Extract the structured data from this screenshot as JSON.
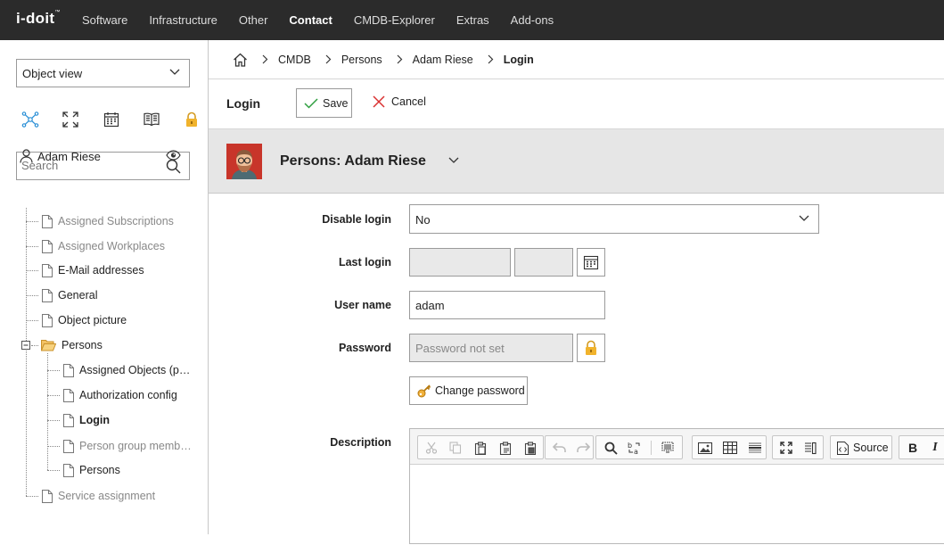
{
  "app": {
    "logo": "i-doit",
    "logo_tm": "™"
  },
  "topnav": {
    "items": [
      "Software",
      "Infrastructure",
      "Other",
      "Contact",
      "CMDB-Explorer",
      "Extras",
      "Add-ons"
    ],
    "active": "Contact"
  },
  "sidebar": {
    "view_select": "Object view",
    "tools": [
      "relations-icon",
      "fullscreen-icon",
      "calendar-icon",
      "book-icon",
      "lock-icon"
    ],
    "search_placeholder": "Search",
    "root": "Adam Riese",
    "items": [
      {
        "label": "Assigned Subscriptions",
        "muted": true
      },
      {
        "label": "Assigned Workplaces",
        "muted": true
      },
      {
        "label": "E-Mail addresses",
        "muted": false
      },
      {
        "label": "General",
        "muted": false
      },
      {
        "label": "Object picture",
        "muted": false
      },
      {
        "label": "Persons",
        "muted": false,
        "folder": true
      },
      {
        "label": "Assigned Objects (p…",
        "muted": false
      },
      {
        "label": "Authorization config",
        "muted": false
      },
      {
        "label": "Login",
        "muted": false,
        "bold": true
      },
      {
        "label": "Person group memb…",
        "muted": true
      },
      {
        "label": "Persons",
        "muted": false
      },
      {
        "label": "Service assignment",
        "muted": true
      }
    ]
  },
  "breadcrumb": [
    "CMDB",
    "Persons",
    "Adam Riese",
    "Login"
  ],
  "actionbar": {
    "title": "Login",
    "save": "Save",
    "cancel": "Cancel"
  },
  "object": {
    "title": "Persons: Adam Riese"
  },
  "form": {
    "disable_login": {
      "label": "Disable login",
      "value": "No"
    },
    "last_login": {
      "label": "Last login",
      "date": "",
      "time": ""
    },
    "username": {
      "label": "User name",
      "value": "adam"
    },
    "password": {
      "label": "Password",
      "placeholder": "Password not set"
    },
    "change_password": "Change password",
    "description": {
      "label": "Description",
      "source_label": "Source"
    }
  },
  "colors": {
    "topbar": "#2b2b2b",
    "header_bg": "#e6e6e6",
    "save_check": "#2e9e3f",
    "cancel_x": "#d93030",
    "key": "#e09a1a",
    "avatar_bg": "#c8352a"
  }
}
